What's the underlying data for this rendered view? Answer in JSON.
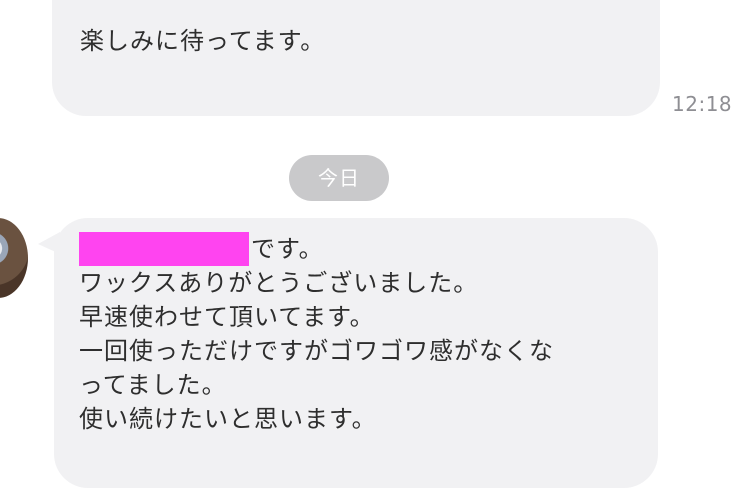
{
  "messages": [
    {
      "text": "楽しみに待ってます。",
      "time": "12:18"
    }
  ],
  "date_divider": "今日",
  "incoming": {
    "lines": [
      "です。",
      "ワックスありがとうございました。",
      "早速使わせて頂いてます。",
      "一回使っただけですがゴワゴワ感がなくな",
      "ってました。",
      "使い続けたいと思います。"
    ]
  },
  "colors": {
    "bubble": "#f1f1f3",
    "timestamp": "#8e8e93",
    "date_pill": "#c9c9cb",
    "redaction": "#ff44f0"
  }
}
